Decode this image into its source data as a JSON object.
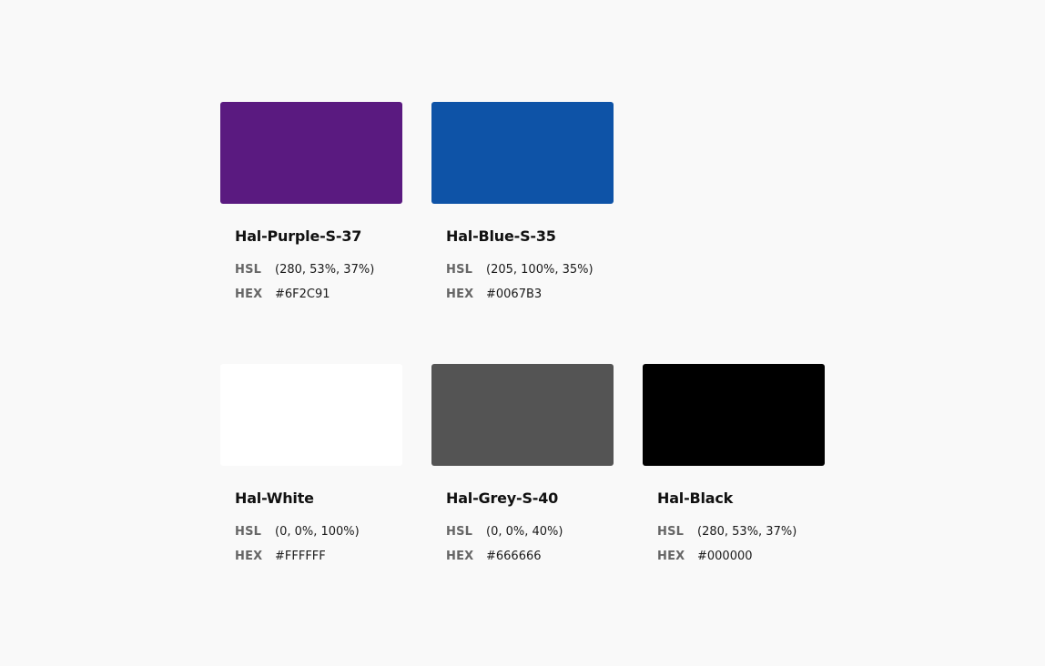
{
  "swatches": [
    {
      "name": "Hal-Purple-S-37",
      "hsl_label": "HSL",
      "hsl": "(280, 53%, 37%)",
      "hex_label": "HEX",
      "hex": "#6F2C91",
      "fill": "#5a1a80"
    },
    {
      "name": "Hal-Blue-S-35",
      "hsl_label": "HSL",
      "hsl": "(205, 100%, 35%)",
      "hex_label": "HEX",
      "hex": "#0067B3",
      "fill": "#0e53a7"
    },
    {
      "name": "Hal-White",
      "hsl_label": "HSL",
      "hsl": "(0, 0%, 100%)",
      "hex_label": "HEX",
      "hex": "#FFFFFF",
      "fill": "#ffffff"
    },
    {
      "name": "Hal-Grey-S-40",
      "hsl_label": "HSL",
      "hsl": "(0, 0%, 40%)",
      "hex_label": "HEX",
      "hex": "#666666",
      "fill": "#545454"
    },
    {
      "name": "Hal-Black",
      "hsl_label": "HSL",
      "hsl": "(280, 53%, 37%)",
      "hex_label": "HEX",
      "hex": "#000000",
      "fill": "#000000"
    }
  ]
}
